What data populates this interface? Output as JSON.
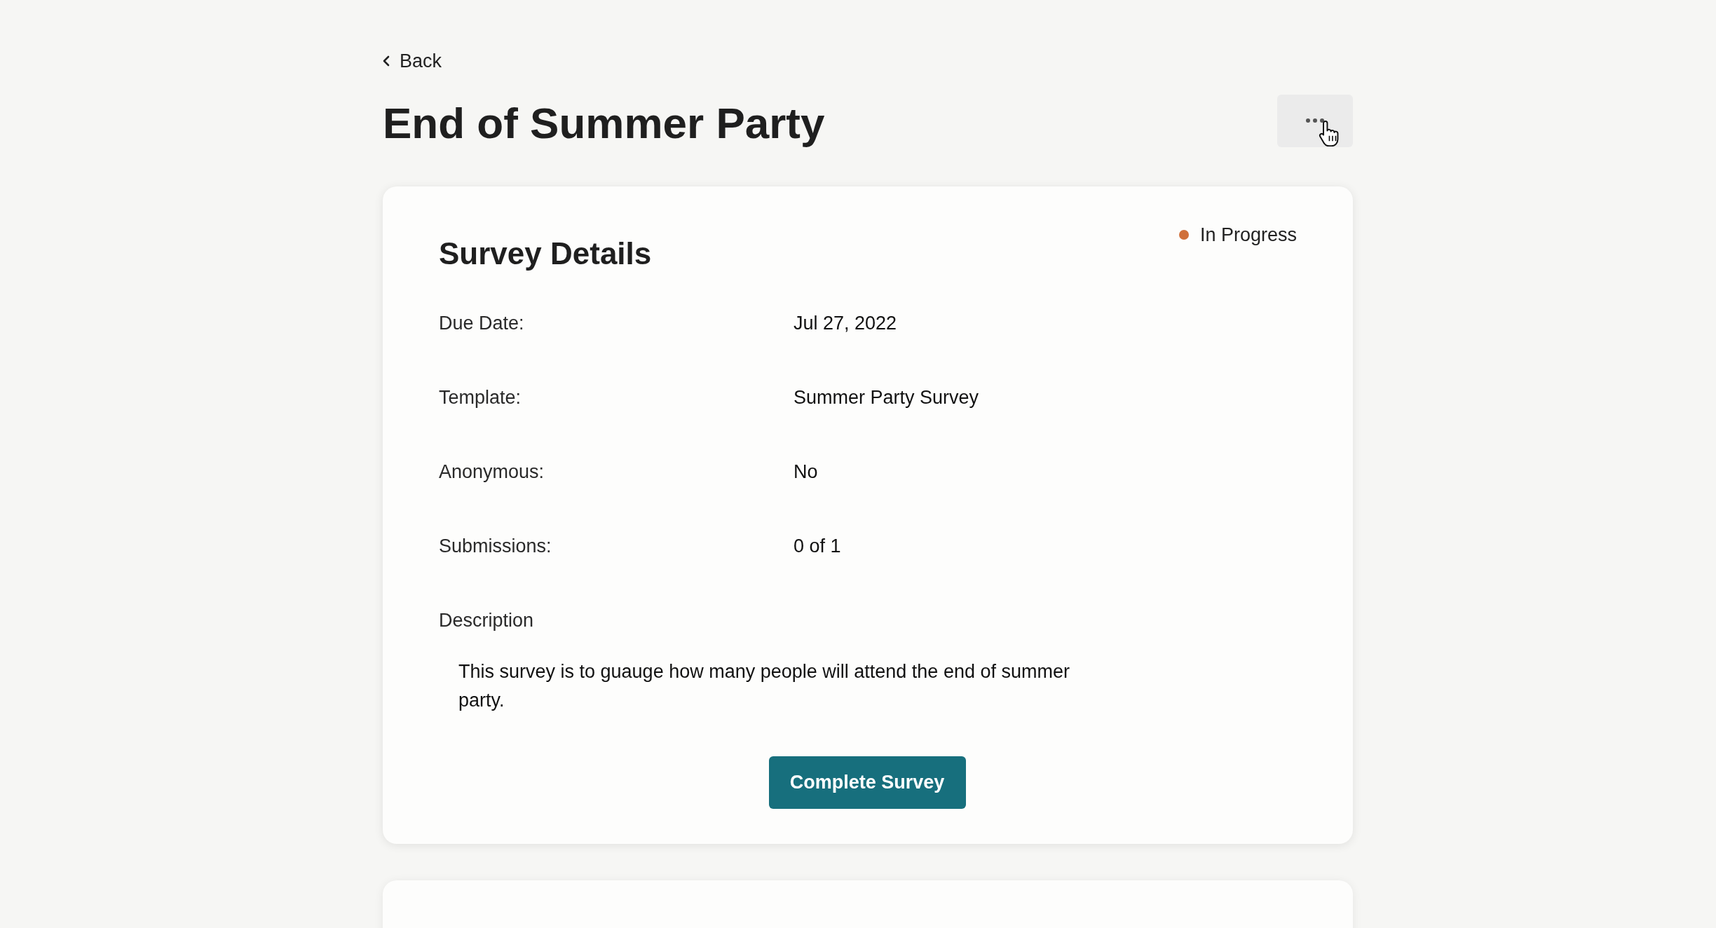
{
  "back_link": {
    "label": "Back"
  },
  "page_title": "End of Summer Party",
  "details_card": {
    "title": "Survey Details",
    "status": {
      "label": "In Progress",
      "color": "#d0703a"
    },
    "fields": [
      {
        "label": "Due Date:",
        "value": "Jul 27, 2022"
      },
      {
        "label": "Template:",
        "value": "Summer Party Survey"
      },
      {
        "label": "Anonymous:",
        "value": "No"
      },
      {
        "label": "Submissions:",
        "value": "0 of 1"
      }
    ],
    "description": {
      "label": "Description",
      "text": "This survey is to guauge how many people will attend the end of summer party."
    },
    "primary_button": {
      "label": "Complete Survey"
    }
  }
}
